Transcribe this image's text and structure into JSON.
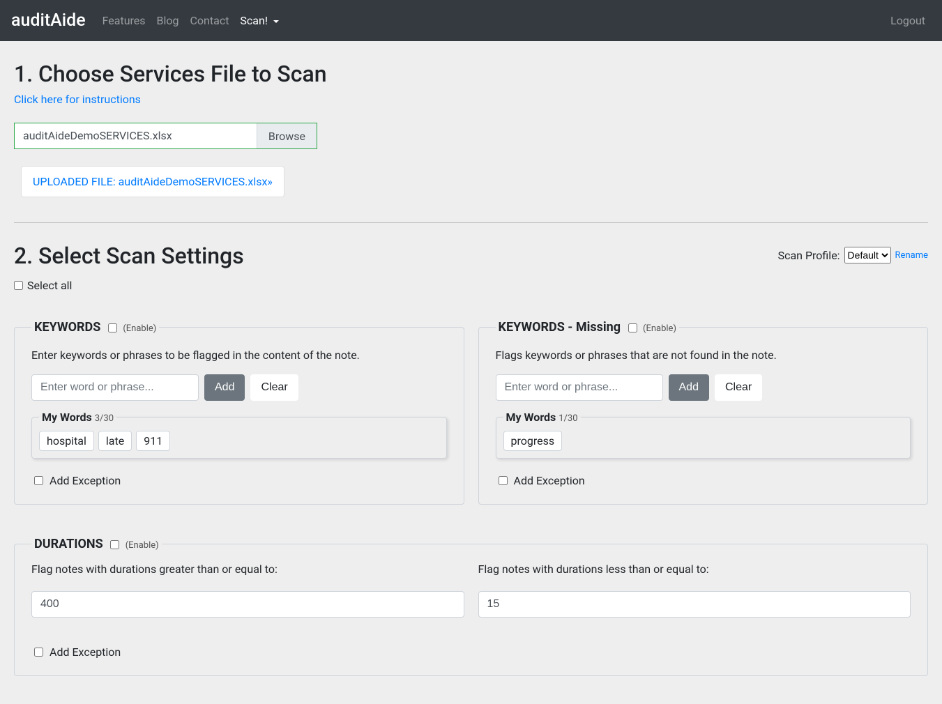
{
  "nav": {
    "brand": "auditAide",
    "items": [
      "Features",
      "Blog",
      "Contact",
      "Scan!"
    ],
    "active_index": 3,
    "logout": "Logout"
  },
  "section1": {
    "title": "1. Choose Services File to Scan",
    "instructions_link": "Click here for instructions",
    "file_name": "auditAideDemoSERVICES.xlsx",
    "browse_label": "Browse",
    "uploaded_text": "UPLOADED FILE: auditAideDemoSERVICES.xlsx»"
  },
  "section2": {
    "title": "2. Select Scan Settings",
    "profile_label": "Scan Profile:",
    "profile_selected": "Default",
    "rename_link": "Rename",
    "select_all": "Select all"
  },
  "keywords": {
    "legend": "KEYWORDS",
    "enable_label": "(Enable)",
    "desc": "Enter keywords or phrases to be flagged in the content of the note.",
    "placeholder": "Enter word or phrase...",
    "add": "Add",
    "clear": "Clear",
    "mywords_label": "My Words",
    "mywords_count": "3/30",
    "words": [
      "hospital",
      "late",
      "911"
    ],
    "exception": "Add Exception"
  },
  "keywords_missing": {
    "legend": "KEYWORDS - Missing",
    "enable_label": "(Enable)",
    "desc": "Flags keywords or phrases that are not found in the note.",
    "placeholder": "Enter word or phrase...",
    "add": "Add",
    "clear": "Clear",
    "mywords_label": "My Words",
    "mywords_count": "1/30",
    "words": [
      "progress"
    ],
    "exception": "Add Exception"
  },
  "durations": {
    "legend": "DURATIONS",
    "enable_label": "(Enable)",
    "gte_label": "Flag notes with durations greater than or equal to:",
    "gte_value": "400",
    "lte_label": "Flag notes with durations less than or equal to:",
    "lte_value": "15",
    "exception": "Add Exception"
  }
}
